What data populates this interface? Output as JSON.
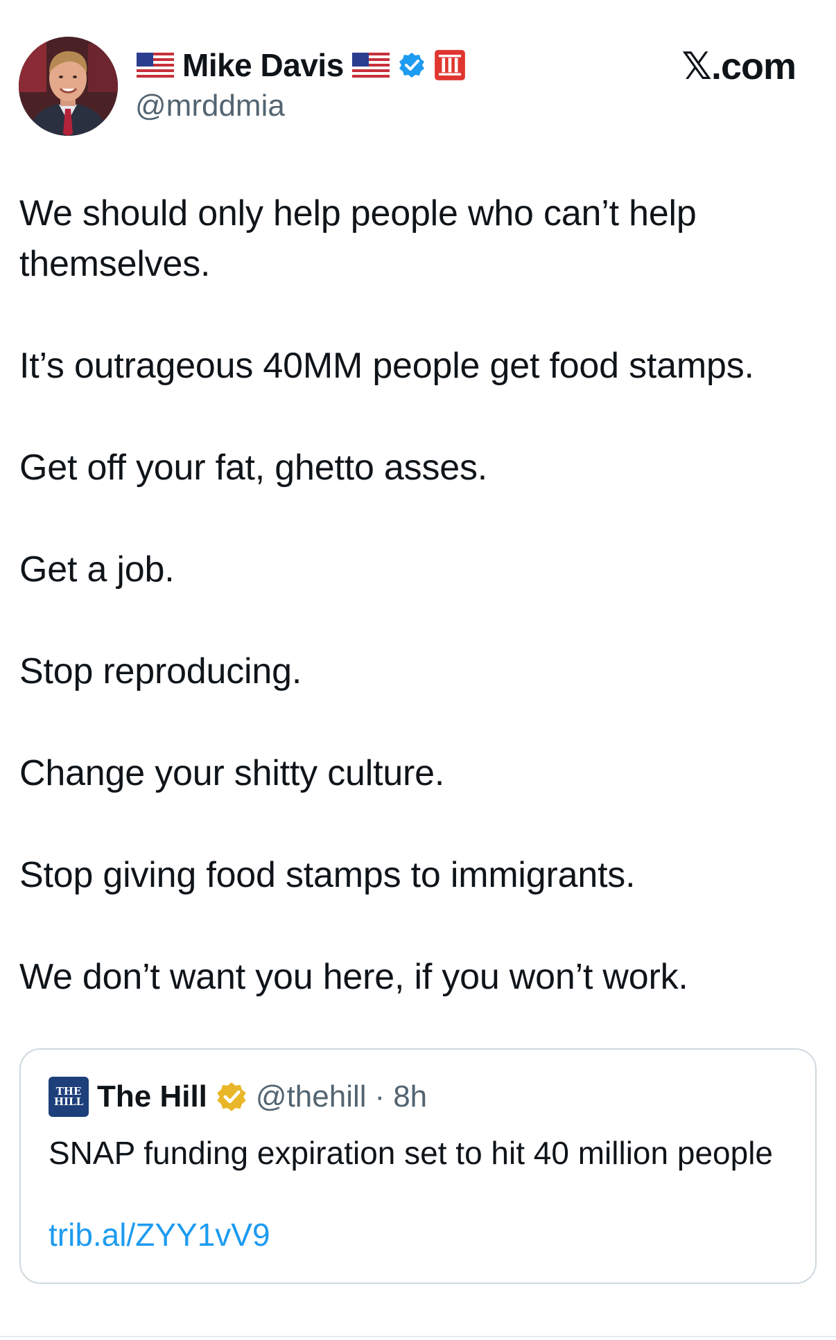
{
  "header": {
    "display_name": "Mike Davis",
    "handle": "@mrddmia",
    "flag_left_icon": "us-flag-icon",
    "flag_right_icon": "us-flag-icon",
    "verified_icon": "blue-verified-badge-icon",
    "extra_badge_icon": "roman-numeral-iii-badge-icon",
    "brand": "𝕏.com",
    "colors": {
      "verified": "#1d9bf0",
      "extra_badge": "#e0362f"
    }
  },
  "tweet": {
    "paragraphs": [
      "We should only help people who can’t help themselves.",
      "It’s outrageous 40MM people get food stamps.",
      "Get off your fat, ghetto asses.",
      "Get a job.",
      "Stop reproducing.",
      "Change your shitty culture.",
      "Stop giving food stamps to immigrants.",
      "We don’t want you here, if you won’t work."
    ]
  },
  "quote": {
    "logo_line1": "THE",
    "logo_line2": "HILL",
    "name": "The Hill",
    "badge_icon": "gold-verified-badge-icon",
    "handle": "@thehill",
    "separator": "·",
    "time": "8h",
    "text": "SNAP funding expiration set to hit 40 million people",
    "link": "trib.al/ZYY1vV9",
    "colors": {
      "link": "#1d9bf0",
      "gold_badge": "#e8b629",
      "logo_bg": "#1d3f7a"
    }
  }
}
